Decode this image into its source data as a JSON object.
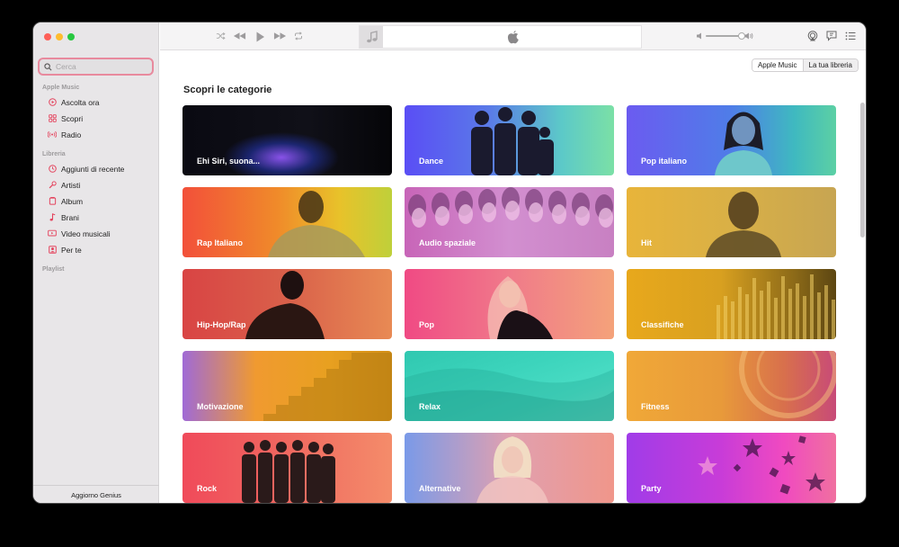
{
  "sidebar": {
    "search_placeholder": "Cerca",
    "section_apple_music": "Apple Music",
    "apple_music_items": [
      {
        "label": "Ascolta ora",
        "icon": "play-circle-icon"
      },
      {
        "label": "Scopri",
        "icon": "grid-icon"
      },
      {
        "label": "Radio",
        "icon": "radio-icon"
      }
    ],
    "section_library": "Libreria",
    "library_items": [
      {
        "label": "Aggiunti di recente",
        "icon": "clock-icon"
      },
      {
        "label": "Artisti",
        "icon": "microphone-icon"
      },
      {
        "label": "Album",
        "icon": "album-icon"
      },
      {
        "label": "Brani",
        "icon": "note-icon"
      },
      {
        "label": "Video musicali",
        "icon": "video-icon"
      },
      {
        "label": "Per te",
        "icon": "person-icon"
      }
    ],
    "section_playlist": "Playlist",
    "footer": "Aggiorno Genius"
  },
  "toolbar": {
    "accent": "#e4425c"
  },
  "main": {
    "segments": [
      "Apple Music",
      "La tua libreria"
    ],
    "heading": "Scopri le categorie",
    "categories": [
      {
        "label": "Ehi Siri, suona..."
      },
      {
        "label": "Dance"
      },
      {
        "label": "Pop italiano"
      },
      {
        "label": "Rap Italiano"
      },
      {
        "label": "Audio spaziale"
      },
      {
        "label": "Hit"
      },
      {
        "label": "Hip-Hop/Rap"
      },
      {
        "label": "Pop"
      },
      {
        "label": "Classifiche"
      },
      {
        "label": "Motivazione"
      },
      {
        "label": "Relax"
      },
      {
        "label": "Fitness"
      },
      {
        "label": "Rock"
      },
      {
        "label": "Alternative"
      },
      {
        "label": "Party"
      }
    ]
  }
}
